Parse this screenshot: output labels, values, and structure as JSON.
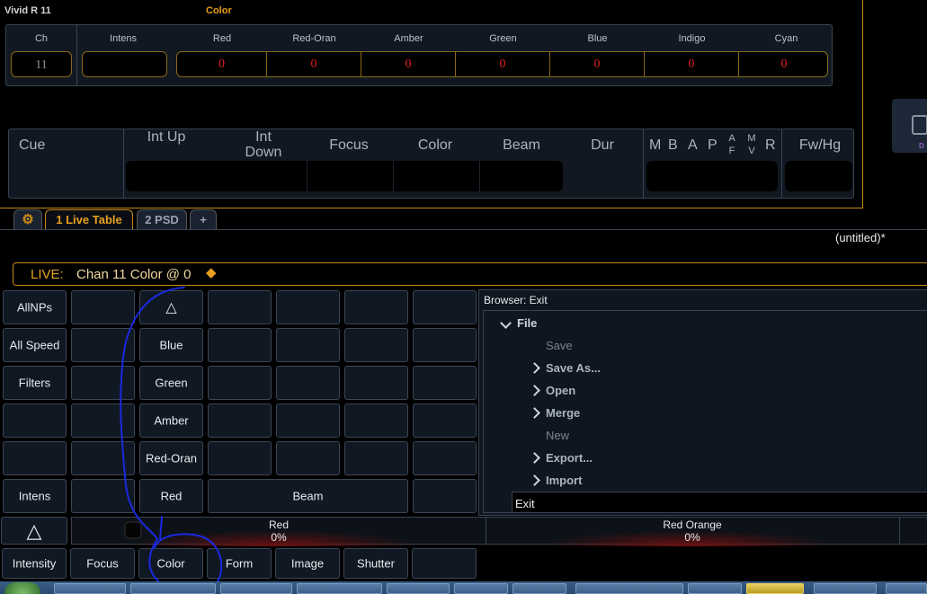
{
  "fixture": {
    "title": "Vivid R 11",
    "section": "Color"
  },
  "params": {
    "headers": [
      "Ch",
      "Intens",
      "Red",
      "Red-Oran",
      "Amber",
      "Green",
      "Blue",
      "Indigo",
      "Cyan"
    ],
    "channel": "11",
    "intensity": "",
    "values": [
      "0",
      "0",
      "0",
      "0",
      "0",
      "0",
      "0"
    ]
  },
  "cue_table": {
    "headers": [
      "Cue",
      "Int Up",
      "Int Down",
      "Focus",
      "Color",
      "Beam",
      "Dur",
      "M",
      "B",
      "A",
      "P",
      "A F",
      "M V",
      "R",
      "Fw/Hg"
    ],
    "edge_label": "D"
  },
  "tabs": [
    {
      "label": "1 Live Table",
      "active": true
    },
    {
      "label": "2 PSD",
      "active": false
    },
    {
      "label": "+",
      "active": false
    }
  ],
  "show_name": "(untitled)*",
  "command_line": {
    "mode": "LIVE:",
    "text": "Chan 11 Color @ 0"
  },
  "palette_buttons": {
    "col1": [
      "AllNPs",
      "All Speed",
      "Filters",
      "",
      "",
      "Intens"
    ],
    "col3": [
      "",
      "Blue",
      "Green",
      "Amber",
      "Red-Oran",
      "Red"
    ],
    "beam": "Beam"
  },
  "browser": {
    "title": "Browser: Exit",
    "root": "File",
    "items": [
      {
        "label": "Save",
        "expandable": false
      },
      {
        "label": "Save As...",
        "expandable": true
      },
      {
        "label": "Open",
        "expandable": true
      },
      {
        "label": "Merge",
        "expandable": true
      },
      {
        "label": "New",
        "expandable": false
      },
      {
        "label": "Export...",
        "expandable": true
      },
      {
        "label": "Import",
        "expandable": true
      }
    ],
    "selected": "Exit"
  },
  "encoders": [
    {
      "name": "Red",
      "value": "0%"
    },
    {
      "name": "Red Orange",
      "value": "0%"
    }
  ],
  "param_tabs": [
    "Intensity",
    "Focus",
    "Color",
    "Form",
    "Image",
    "Shutter",
    ""
  ],
  "colors": {
    "accent": "#c8881a",
    "value_red": "#e02020",
    "annotation": "#1a2adf"
  }
}
